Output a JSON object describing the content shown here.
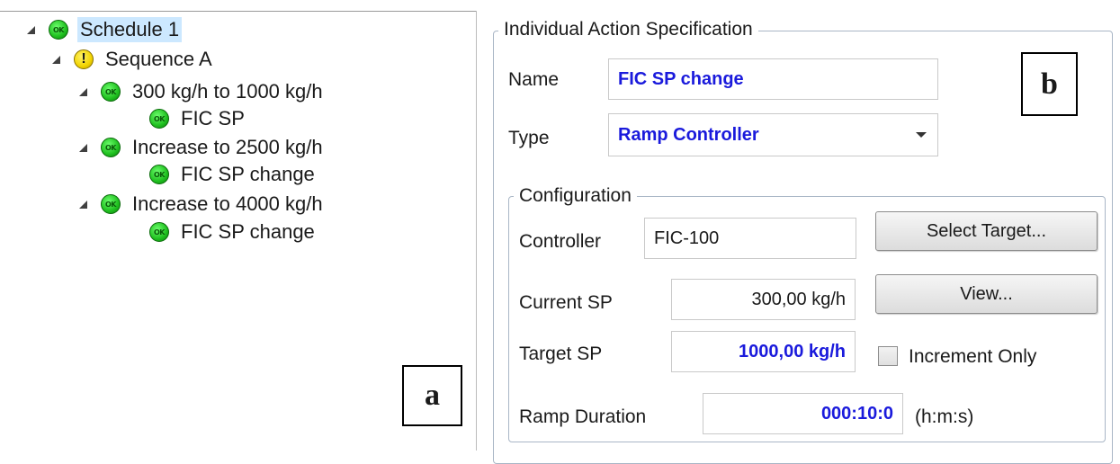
{
  "tree": {
    "items": [
      {
        "label": "Schedule 1",
        "status": "ok",
        "expanded": true,
        "selected": true
      },
      {
        "label": "Sequence A",
        "status": "warning",
        "expanded": true
      },
      {
        "label": "300 kg/h to 1000 kg/h",
        "status": "ok",
        "expanded": true
      },
      {
        "label": "FIC SP",
        "status": "ok"
      },
      {
        "label": "Increase to 2500 kg/h",
        "status": "ok",
        "expanded": true
      },
      {
        "label": "FIC SP change",
        "status": "ok"
      },
      {
        "label": "Increase to 4000 kg/h",
        "status": "ok",
        "expanded": true
      },
      {
        "label": "FIC SP change",
        "status": "ok"
      }
    ],
    "ok_icon_text": "OK",
    "warn_icon_text": "!",
    "panel_label": "a"
  },
  "spec": {
    "group_title": "Individual Action Specification",
    "panel_label": "b",
    "name_label": "Name",
    "name_value": "FIC SP change",
    "type_label": "Type",
    "type_value": "Ramp Controller",
    "config": {
      "title": "Configuration",
      "controller_label": "Controller",
      "controller_value": "FIC-100",
      "select_target_button": "Select Target...",
      "current_sp_label": "Current SP",
      "current_sp_value": "300,00 kg/h",
      "view_button": "View...",
      "target_sp_label": "Target SP",
      "target_sp_value": "1000,00 kg/h",
      "increment_only_label": "Increment Only",
      "increment_only_checked": false,
      "ramp_duration_label": "Ramp Duration",
      "ramp_duration_value": "000:10:0",
      "ramp_duration_unit": "(h:m:s)"
    }
  },
  "colors": {
    "accent_text": "#1a1adc",
    "selection": "#cce8ff",
    "ok_green": "#1fbf1f",
    "warn_yellow": "#f2d400"
  }
}
